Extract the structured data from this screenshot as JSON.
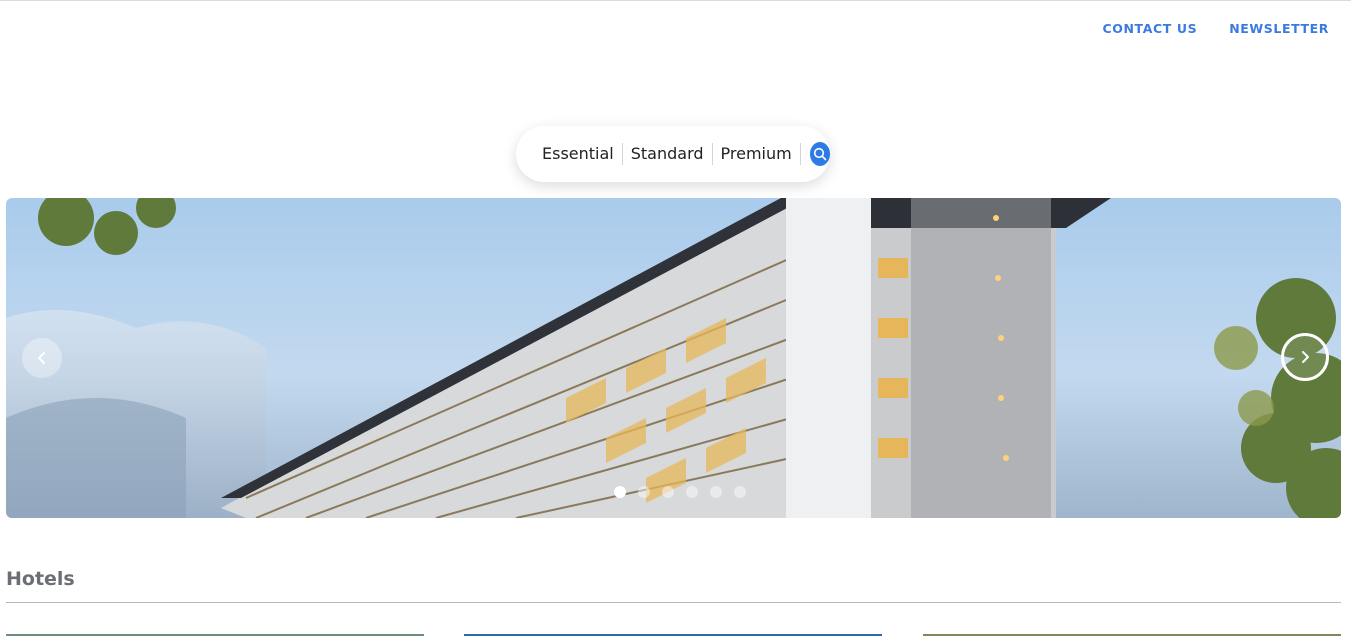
{
  "nav": {
    "contact_label": "CONTACT US",
    "newsletter_label": "NEWSLETTER"
  },
  "tiers": {
    "items": [
      "Essential",
      "Standard",
      "Premium"
    ]
  },
  "carousel": {
    "slide_count": 6,
    "active_index": 0
  },
  "hotels": {
    "title": "Hotels"
  },
  "colors": {
    "accent": "#3a7be0",
    "search_button": "#2f7be6",
    "section_title": "#6b6f75"
  }
}
